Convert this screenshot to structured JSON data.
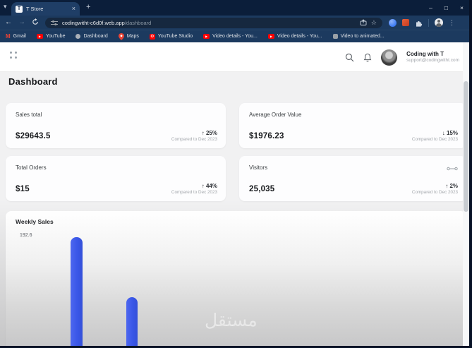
{
  "browser": {
    "tab_title": "T Store",
    "tab_favicon_letter": "T",
    "tab_close_glyph": "×",
    "new_tab_glyph": "+",
    "tab_search_chevron_glyph": "▾",
    "window_controls": {
      "minimize": "–",
      "maximize": "□",
      "close": "×"
    },
    "nav": {
      "back_glyph": "←",
      "forward_glyph": "→"
    },
    "address": {
      "domain": "codingwitht-c6d0f.web.app",
      "path": "/dashboard",
      "star_glyph": "☆"
    },
    "menu_dots_glyph": "⋮",
    "youtube_play_glyph": "▶",
    "studio_gear_glyph": "⚙",
    "bookmarks": [
      {
        "label": "Gmail",
        "icon": "gmail-icon",
        "brand_color": "#ea4335"
      },
      {
        "label": "YouTube",
        "icon": "youtube-icon",
        "brand_color": "#ff0000"
      },
      {
        "label": "Dashboard",
        "icon": "dashboard-favicon-icon",
        "brand_color": "#aab0b8"
      },
      {
        "label": "Maps",
        "icon": "maps-pin-icon",
        "brand_color": "#ea4335"
      },
      {
        "label": "YouTube Studio",
        "icon": "youtube-studio-icon",
        "brand_color": "#ff0000"
      },
      {
        "label": "Video details - You...",
        "icon": "youtube-icon",
        "brand_color": "#ff0000"
      },
      {
        "label": "Video details - You...",
        "icon": "youtube-icon",
        "brand_color": "#ff0000"
      },
      {
        "label": "Video to animated...",
        "icon": "generic-favicon-icon",
        "brand_color": "#9aa0a6"
      }
    ],
    "theme_colors": {
      "frame": "#0b1e3a",
      "toolbar": "#1c3a5f",
      "active_tab": "#1f3e66",
      "omnibox": "#16283f"
    }
  },
  "app_header": {
    "user_name": "Coding with T",
    "user_email": "support@codingwitht.com"
  },
  "page": {
    "title": "Dashboard",
    "background_color": "#f1f1f2",
    "cards": [
      {
        "label": "Sales total",
        "value": "$29643.5",
        "delta_arrow": "↑",
        "delta_pct": "25%",
        "compare_text": "Compared to Dec 2023"
      },
      {
        "label": "Average Order Value",
        "value": "$1976.23",
        "delta_arrow": "↓",
        "delta_pct": "15%",
        "compare_text": "Compared to Dec 2023"
      },
      {
        "label": "Total Orders",
        "value": "$15",
        "delta_arrow": "↑",
        "delta_pct": "44%",
        "compare_text": "Compared to Dec 2023"
      },
      {
        "label": "Visitors",
        "value": "25,035",
        "delta_arrow": "↑",
        "delta_pct": "2%",
        "compare_text": "Compared to Dec 2023"
      }
    ],
    "watermark": "مستقل"
  },
  "chart_data": {
    "type": "bar",
    "title": "Weekly Sales",
    "y_axis_max": 192.6,
    "y_tick_labels": [
      "192.6"
    ],
    "bar_color": "#3a57e8",
    "bars": [
      {
        "value": 192.6
      },
      {
        "value": 117
      }
    ],
    "layout_note": "chart is cut off by viewport bottom; only two bars and the top y-axis tick are visible, x-axis labels not visible, no gridlines"
  }
}
